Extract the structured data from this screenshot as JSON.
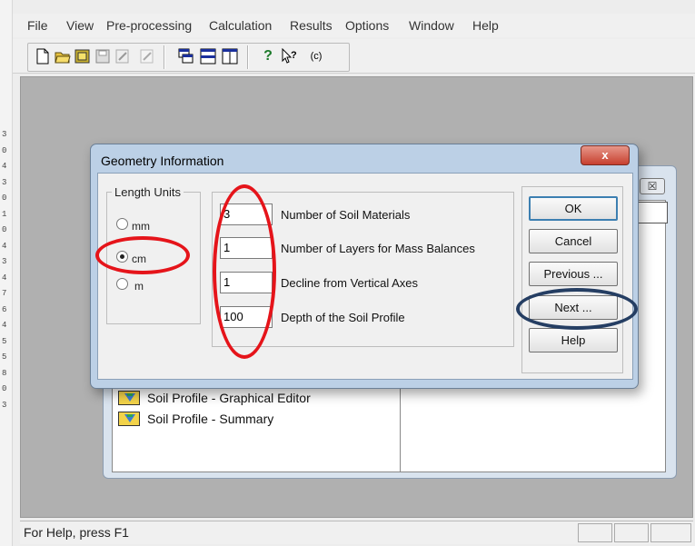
{
  "menu": [
    "File",
    "View",
    "Pre-processing",
    "Calculation",
    "Results",
    "Options",
    "Window",
    "Help"
  ],
  "left_strip_chars": [
    "3",
    "0",
    "4",
    "3",
    "0",
    "1",
    "0",
    "4",
    "3",
    "4",
    "7",
    "6",
    "4",
    "5",
    "5",
    "8",
    "0",
    "3"
  ],
  "toolbar": {
    "icons": [
      "new-file-icon",
      "open-folder-icon",
      "open-project-icon",
      "save-icon",
      "edit-icon",
      "cascade-windows-icon",
      "tile-horizontal-icon",
      "tile-vertical-icon",
      "help-icon",
      "context-help-icon"
    ],
    "copyright_label": "(c)"
  },
  "background_window": {
    "close_glyph": "☒",
    "items": [
      {
        "label": "Soil Profile - Graphical Editor",
        "icon": "soil-profile-icon"
      },
      {
        "label": "Soil Profile - Summary",
        "icon": "soil-profile-icon"
      }
    ]
  },
  "dialog": {
    "title": "Geometry Information",
    "close_glyph": "x",
    "units": {
      "label": "Length Units",
      "options": [
        {
          "label": "mm",
          "selected": false
        },
        {
          "label": "cm",
          "selected": true
        },
        {
          "label": "m",
          "selected": false
        }
      ]
    },
    "fields": [
      {
        "value": "3",
        "label": "Number of Soil Materials"
      },
      {
        "value": "1",
        "label": "Number of Layers for Mass Balances"
      },
      {
        "value": "1",
        "label": "Decline from Vertical Axes"
      },
      {
        "value": "100",
        "label": "Depth of the Soil Profile"
      }
    ],
    "buttons": {
      "ok": "OK",
      "cancel": "Cancel",
      "previous": "Previous ...",
      "next": "Next ...",
      "help": "Help"
    }
  },
  "status_bar": {
    "text": "For Help, press F1"
  },
  "colors": {
    "annotation_red": "#e5141a",
    "annotation_navy": "#253e63",
    "dialog_frame": "#bcd0e6"
  }
}
